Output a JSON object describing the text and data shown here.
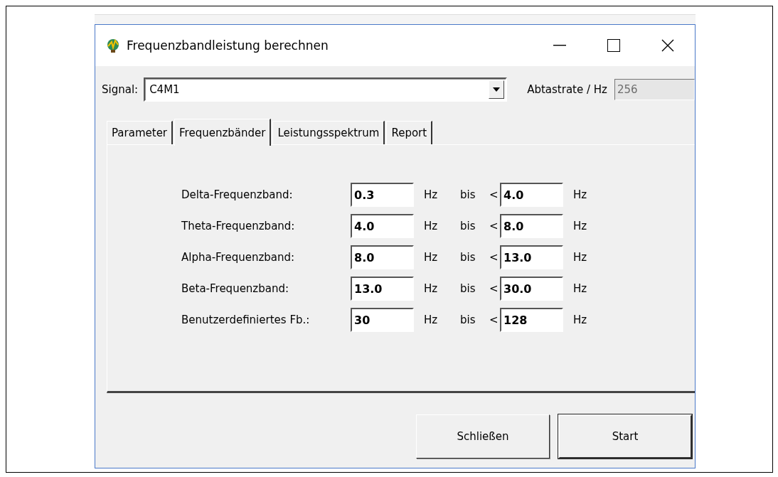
{
  "window": {
    "title": "Frequenzbandleistung berechnen"
  },
  "signal": {
    "label": "Signal:",
    "value": "C4M1"
  },
  "sample_rate": {
    "label": "Abtastrate / Hz",
    "value": "256",
    "disabled": true
  },
  "tabs": [
    {
      "label": "Parameter",
      "selected": false
    },
    {
      "label": "Frequenzbänder",
      "selected": true
    },
    {
      "label": "Leistungsspektrum",
      "selected": false
    },
    {
      "label": "Report",
      "selected": false
    }
  ],
  "bands": [
    {
      "label": "Delta-Frequenzband:",
      "from": "0.3",
      "unit_1": "Hz",
      "bis": "bis",
      "lt": "<",
      "to": "4.0",
      "unit_2": "Hz"
    },
    {
      "label": "Theta-Frequenzband:",
      "from": "4.0",
      "unit_1": "Hz",
      "bis": "bis",
      "lt": "<",
      "to": "8.0",
      "unit_2": "Hz"
    },
    {
      "label": "Alpha-Frequenzband:",
      "from": "8.0",
      "unit_1": "Hz",
      "bis": "bis",
      "lt": "<",
      "to": "13.0",
      "unit_2": "Hz"
    },
    {
      "label": "Beta-Frequenzband:",
      "from": "13.0",
      "unit_1": "Hz",
      "bis": "bis",
      "lt": "<",
      "to": "30.0",
      "unit_2": "Hz"
    },
    {
      "label": "Benutzerdefiniertes Fb.:",
      "from": "30",
      "unit_1": "Hz",
      "bis": "bis",
      "lt": "<",
      "to": "128",
      "unit_2": "Hz"
    }
  ],
  "buttons": [
    {
      "label": "Schließen",
      "kind": "normal"
    },
    {
      "label": "Start",
      "kind": "default"
    }
  ]
}
